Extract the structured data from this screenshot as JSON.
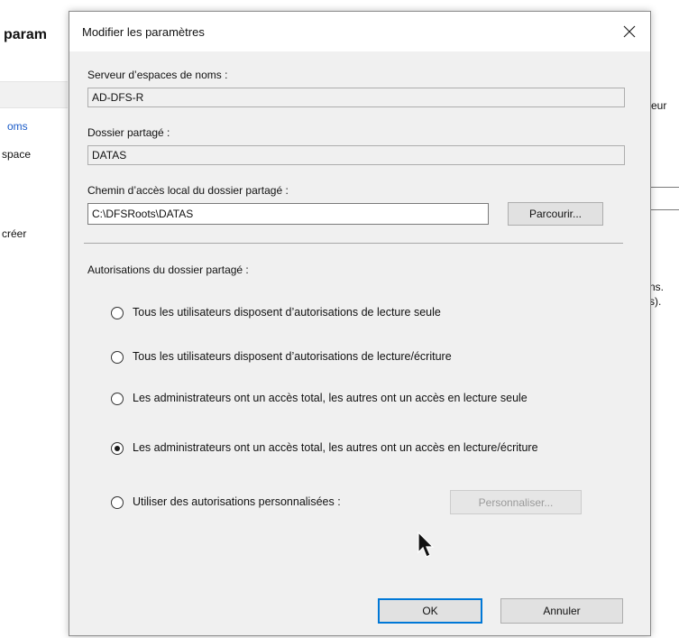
{
  "background": {
    "title_fragment": "param",
    "nav_link_fragment": "oms",
    "nav_espace_fragment": "space",
    "nav_creer_fragment": "créer",
    "right_fragment": "eur",
    "right_lines": [
      "ns.",
      "s)."
    ]
  },
  "dialog": {
    "title": "Modifier les paramètres",
    "close_icon": "close-icon",
    "namespace_server": {
      "label": "Serveur d’espaces de noms :",
      "value": "AD-DFS-R"
    },
    "shared_folder": {
      "label": "Dossier partagé :",
      "value": "DATAS"
    },
    "local_path": {
      "label": "Chemin d’accès local du dossier partagé :",
      "value": "C:\\DFSRoots\\DATAS",
      "browse_label": "Parcourir..."
    },
    "permissions": {
      "label": "Autorisations du dossier partagé :",
      "options": [
        {
          "label": "Tous les utilisateurs disposent d’autorisations de lecture seule",
          "checked": false
        },
        {
          "label": "Tous les utilisateurs disposent d’autorisations de lecture/écriture",
          "checked": false
        },
        {
          "label": "Les administrateurs ont un accès total, les autres ont un accès en lecture seule",
          "checked": false
        },
        {
          "label": "Les administrateurs ont un accès total, les autres ont un accès en lecture/écriture",
          "checked": true
        },
        {
          "label": "Utiliser des autorisations personnalisées :",
          "checked": false
        }
      ],
      "customize_label": "Personnaliser..."
    },
    "ok_label": "OK",
    "cancel_label": "Annuler"
  }
}
